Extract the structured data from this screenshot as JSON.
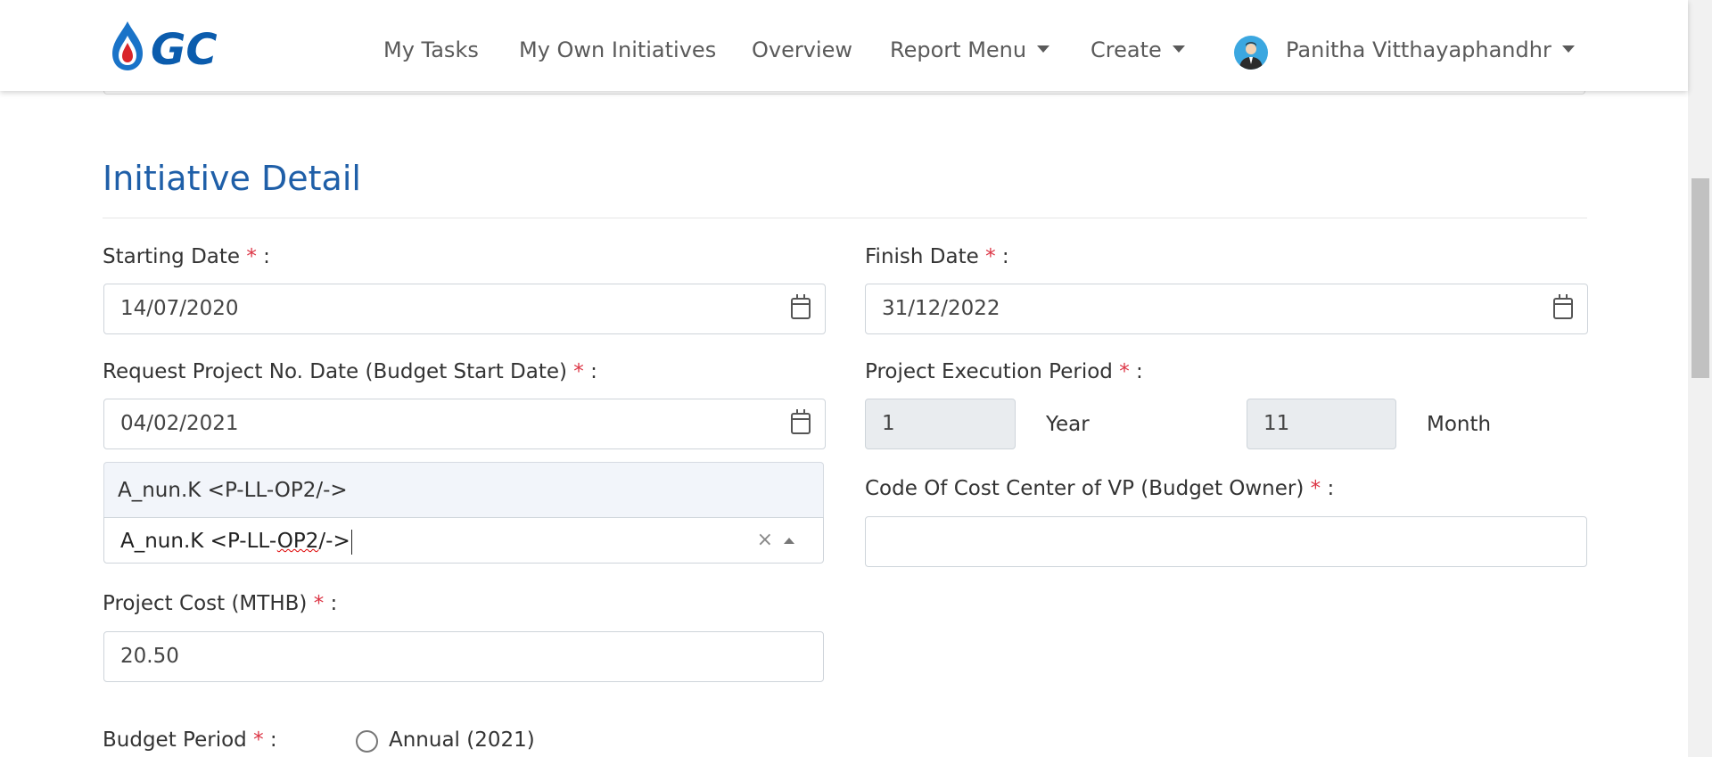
{
  "navbar": {
    "logo_text": "GC",
    "items": [
      {
        "label": "My Tasks"
      },
      {
        "label": "My Own Initiatives"
      },
      {
        "label": "Overview"
      },
      {
        "label": "Report Menu"
      },
      {
        "label": "Create"
      }
    ],
    "user_name": "Panitha Vitthayaphandhr"
  },
  "section": {
    "title": "Initiative Detail"
  },
  "form": {
    "starting_date": {
      "label": "Starting Date",
      "value": "14/07/2020"
    },
    "finish_date": {
      "label": "Finish Date",
      "value": "31/12/2022"
    },
    "request_date": {
      "label": "Request Project No. Date (Budget Start Date)",
      "value": "04/02/2021"
    },
    "execution_period": {
      "label": "Project Execution Period",
      "year_value": "1",
      "year_unit": "Year",
      "month_value": "11",
      "month_unit": "Month"
    },
    "owner_select": {
      "option": "A_nun.K <P-LL-OP2/->",
      "value_prefix": "A_nun.K <P-LL-",
      "value_misspelled": "OP2",
      "value_suffix": "/->",
      "clear_symbol": "×"
    },
    "cost_center": {
      "label": "Code Of Cost Center of VP (Budget Owner)",
      "value": ""
    },
    "project_cost": {
      "label": "Project Cost (MTHB)",
      "value": "20.50"
    },
    "budget_period": {
      "label": "Budget Period",
      "option_annual": "Annual (2021)"
    }
  },
  "required_mark": "*",
  "colon": ":",
  "colors": {
    "title": "#1f5fa8",
    "required": "#dc3545",
    "brand": "#0b5cad"
  }
}
